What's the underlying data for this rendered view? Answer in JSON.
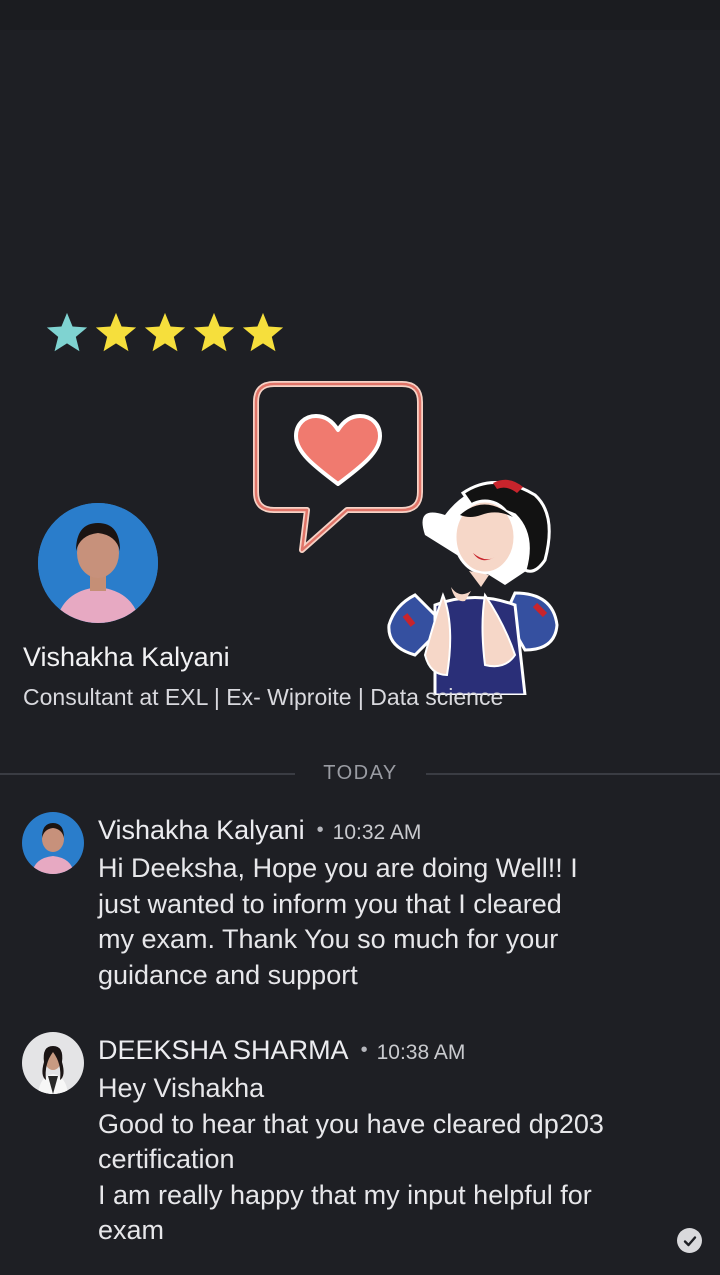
{
  "rating": {
    "stars": 5,
    "first_star_color": "#7fd3d1",
    "star_color": "#f6df3c"
  },
  "profile": {
    "name": "Vishakha Kalyani",
    "headline": "Consultant at EXL | Ex- Wiproite | Data science"
  },
  "separator": {
    "label": "TODAY"
  },
  "messages": [
    {
      "sender": "Vishakha Kalyani",
      "dot": "•",
      "time": "10:32 AM",
      "lines": [
        "Hi Deeksha, Hope you are doing Well!! I",
        "just wanted to inform you that I cleared",
        "my exam. Thank You so much for your",
        "guidance and support"
      ]
    },
    {
      "sender": "DEEKSHA SHARMA",
      "dot": "•",
      "time": "10:38 AM",
      "lines": [
        "Hey Vishakha",
        "Good to hear that you have cleared dp203",
        "certification",
        "I am really happy that my input helpful for",
        "exam"
      ]
    }
  ],
  "icons": {
    "heart_bubble": "heart-speech-bubble-sticker",
    "princess": "princess-sticker",
    "read_receipt": "check-circle-icon"
  },
  "colors": {
    "background": "#1e1f24",
    "heart": "#f07a6f",
    "bubble_border": "#f1b8a8"
  }
}
